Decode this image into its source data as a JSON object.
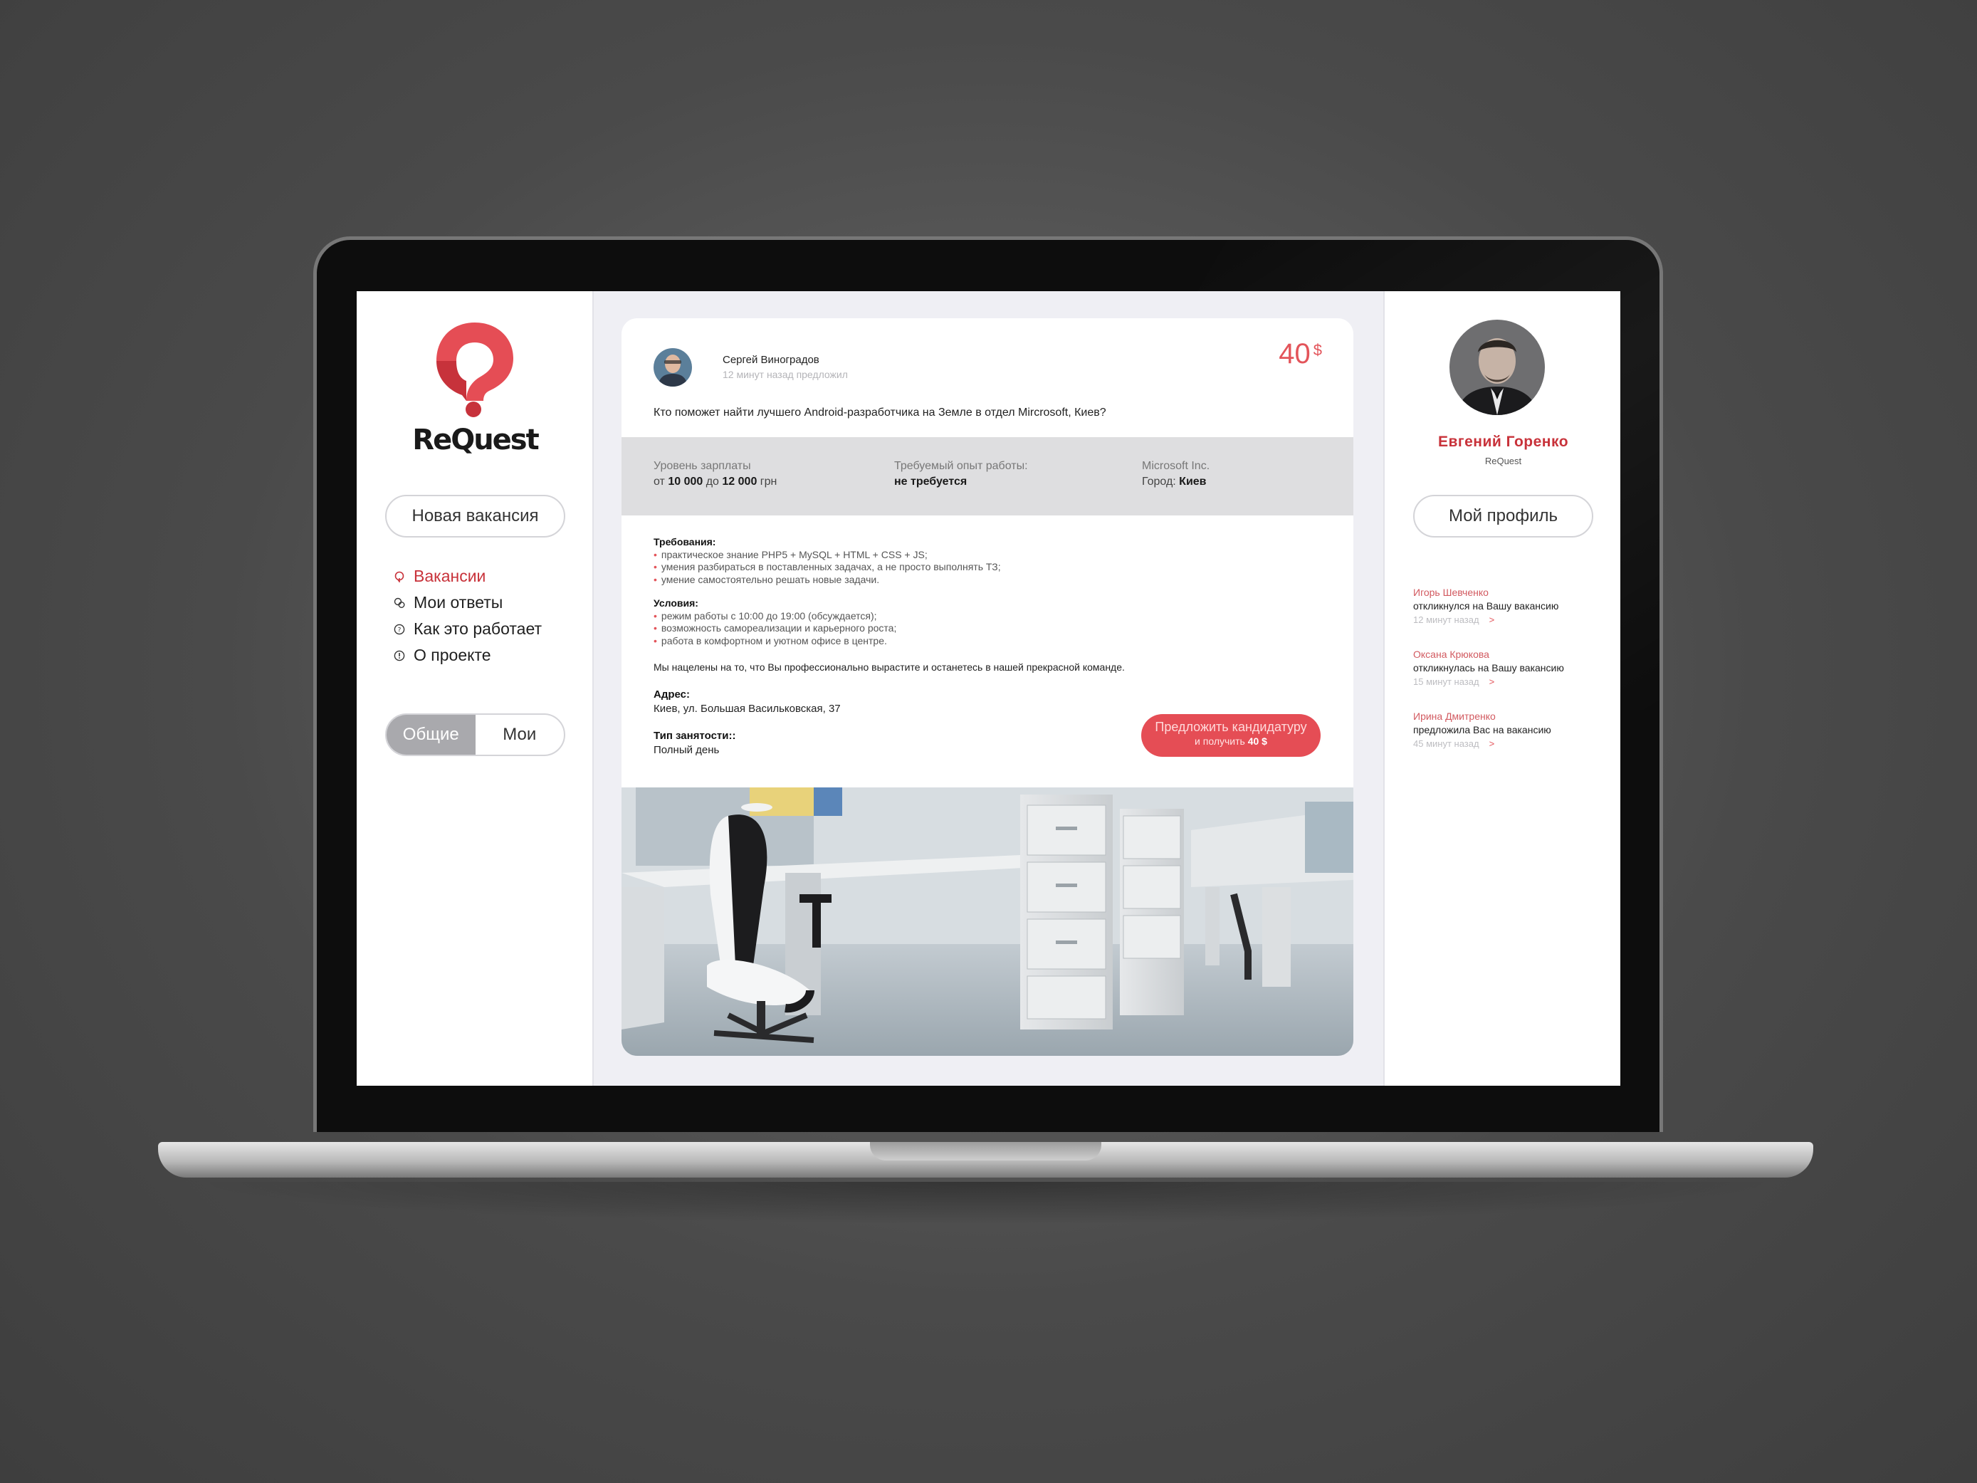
{
  "brand": {
    "name": "ReQuest",
    "accent": "#e54d55"
  },
  "sidebar": {
    "new_vacancy_label": "Новая вакансия",
    "nav": [
      {
        "label": "Вакансии",
        "icon": "location-pin-icon",
        "active": true
      },
      {
        "label": "Мои ответы",
        "icon": "chat-bubbles-icon",
        "active": false
      },
      {
        "label": "Как это работает",
        "icon": "question-circle-icon",
        "active": false
      },
      {
        "label": "О проекте",
        "icon": "info-circle-icon",
        "active": false
      }
    ],
    "toggle": {
      "left": "Общие",
      "right": "Мои",
      "selected": "Общие"
    }
  },
  "post": {
    "author": "Сергей Виноградов",
    "time": "12 минут назад предложил",
    "reward_amount": "40",
    "reward_currency": "$",
    "question": "Кто поможет найти лучшего Android-разработчика на Земле в отдел Mircrosoft, Киев?",
    "salary": {
      "label": "Уровень зарплаты",
      "from": "от",
      "min": "10 000",
      "to": "до",
      "max": "12 000",
      "unit": "грн"
    },
    "experience": {
      "label": "Требуемый опыт работы:",
      "value": "не требуется"
    },
    "company": {
      "name": "Microsoft Inc.",
      "city_label": "Город:",
      "city": "Киев"
    },
    "requirements": {
      "title": "Требования:",
      "items": [
        "практическое знание PHP5 + MySQL + HTML + CSS + JS;",
        "умения разбираться в поставленных задачах, а не просто выполнять ТЗ;",
        "умение самостоятельно решать новые задачи."
      ]
    },
    "conditions": {
      "title": "Условия:",
      "items": [
        "режим работы с 10:00 до 19:00 (обсуждается);",
        "возможность самореализации и карьерного роста;",
        "работа в комфортном и уютном офисе в центре."
      ]
    },
    "pitch": "Мы нацелены на то, что Вы профессионально вырастите и останетесь в нашей прекрасной команде.",
    "address": {
      "label": "Адрес:",
      "value": "Киев, ул. Большая Васильковская, 37"
    },
    "employment": {
      "label": "Тип занятости::",
      "value": "Полный день"
    },
    "offer_button": {
      "line1": "Предложить кандидатуру",
      "line2": "и получить",
      "amount": "40 $"
    }
  },
  "profile": {
    "name": "Евгений Горенко",
    "company": "ReQuest",
    "my_profile_label": "Мой профиль"
  },
  "feed": [
    {
      "name": "Игорь Шевченко",
      "action": "откликнулся на Вашу вакансию",
      "time": "12 минут назад",
      "arrow": ">"
    },
    {
      "name": "Оксана Крюкова",
      "action": "откликнулась на Вашу вакансию",
      "time": "15 минут назад",
      "arrow": ">"
    },
    {
      "name": "Ирина Дмитренко",
      "action": "предложила Вас на вакансию",
      "time": "45 минут назад",
      "arrow": ">"
    }
  ]
}
